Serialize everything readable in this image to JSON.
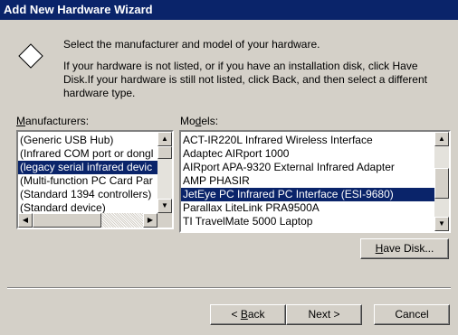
{
  "window": {
    "title": "Add New Hardware Wizard"
  },
  "intro": {
    "line1": "Select the manufacturer and model of your hardware.",
    "line2": "If your hardware is not listed, or if you have an installation disk, click Have Disk.If your hardware is still not listed, click Back, and then select a different hardware type."
  },
  "manufacturers": {
    "label_pre": "",
    "label_key": "M",
    "label_post": "anufacturers:",
    "items": [
      "(Generic USB Hub)",
      "(Infrared COM port or dongl",
      "(legacy serial infrared devic",
      "(Multi-function PC Card Par",
      "(Standard 1394 controllers)",
      "(Standard device)"
    ],
    "selected_index": 2
  },
  "models": {
    "label_pre": "Mo",
    "label_key": "d",
    "label_post": "els:",
    "items": [
      "ACT-IR220L Infrared Wireless Interface",
      "Adaptec AIRport 1000",
      "AIRport APA-9320 External Infrared Adapter",
      "AMP PHASIR",
      "JetEye PC Infrared PC Interface (ESI-9680)",
      "Parallax LiteLink PRA9500A",
      "TI TravelMate 5000 Laptop"
    ],
    "selected_index": 4
  },
  "buttons": {
    "have_disk_key": "H",
    "have_disk_post": "ave Disk...",
    "back_pre": "< ",
    "back_key": "B",
    "back_post": "ack",
    "next": "Next >",
    "cancel": "Cancel"
  },
  "icons": {
    "header": "diamond-icon",
    "up": "arrow-up-icon",
    "down": "arrow-down-icon",
    "left": "arrow-left-icon",
    "right": "arrow-right-icon"
  },
  "colors": {
    "titlebar": "#0a246a",
    "selection": "#0a246a",
    "face": "#d4d0c8"
  }
}
